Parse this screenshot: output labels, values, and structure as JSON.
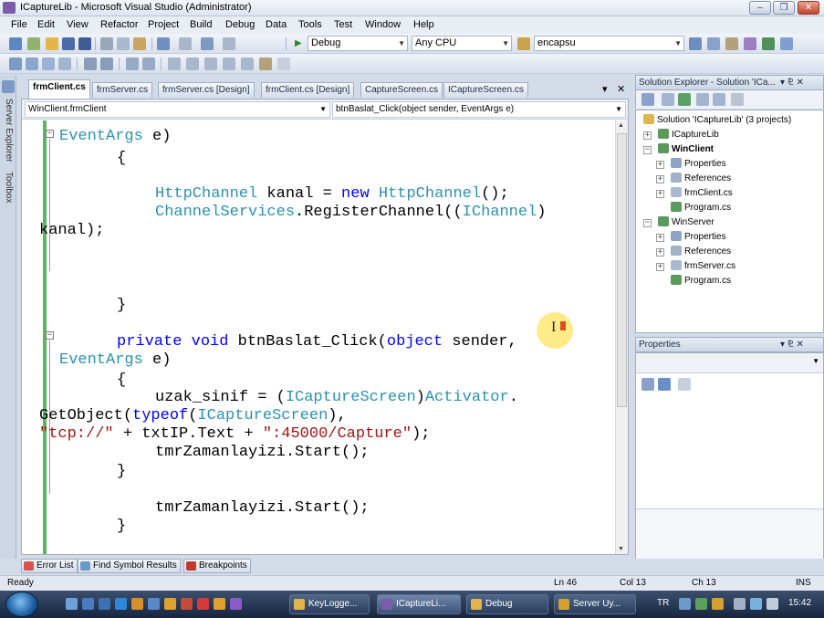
{
  "window": {
    "title": "ICaptureLib - Microsoft Visual Studio (Administrator)",
    "min_label": "–",
    "max_label": "❐",
    "close_label": "✕"
  },
  "menu": [
    "File",
    "Edit",
    "View",
    "Refactor",
    "Project",
    "Build",
    "Debug",
    "Data",
    "Tools",
    "Test",
    "Window",
    "Help"
  ],
  "toolbar": {
    "config": "Debug",
    "platform": "Any CPU",
    "find": "encapsu"
  },
  "left_strip": {
    "server_explorer": "Server Explorer",
    "toolbox": "Toolbox"
  },
  "doc_tabs": [
    "frmClient.cs",
    "frmServer.cs",
    "frmServer.cs [Design]",
    "frmClient.cs [Design]",
    "CaptureScreen.cs",
    "ICaptureScreen.cs"
  ],
  "doc_tabs_controls": {
    "dropdown": "▾",
    "close": "✕"
  },
  "navbar": {
    "class_combo": "WinClient.frmClient",
    "member_combo": "btnBaslat_Click(object sender, EventArgs e)"
  },
  "code": {
    "l1_type": "EventArgs",
    "l1_rest": " e)",
    "l2": "{",
    "l3_t1": "HttpChannel",
    "l3_mid": " kanal = ",
    "l3_kw": "new",
    "l3_sp": " ",
    "l3_t2": "HttpChannel",
    "l3_end": "();",
    "l4_t1": "ChannelServices",
    "l4_mid": ".RegisterChannel((",
    "l4_t2": "IChannel",
    "l4_end": ")",
    "l5": "kanal);",
    "l6": "}",
    "l7_kw1": "private",
    "l7_sp": " ",
    "l7_kw2": "void",
    "l7_mid": " btnBaslat_Click(",
    "l7_kw3": "object",
    "l7_end": " sender,",
    "l8_type": "EventArgs",
    "l8_rest": " e)",
    "l9": "{",
    "l10_a": "uzak_sinif = (",
    "l10_t1": "ICaptureScreen",
    "l10_b": ")",
    "l10_t2": "Activator",
    "l10_c": ".",
    "l11_a": "GetObject(",
    "l11_kw": "typeof",
    "l11_b": "(",
    "l11_t": "ICaptureScreen",
    "l11_c": "),",
    "l12_s1": "\"tcp://\"",
    "l12_mid": " + txtIP.Text + ",
    "l12_s2": "\":45000/Capture\"",
    "l12_end": ");",
    "l13": "tmrZamanlayizi.Start();",
    "l14": "}",
    "l15": "tmrZamanlayizi.Start();",
    "l16": "}"
  },
  "bottom_tabs": [
    "Error List",
    "Find Symbol Results",
    "Breakpoints"
  ],
  "solution_explorer": {
    "title": "Solution Explorer - Solution 'ICa...",
    "pin": "▾ ⅊ ✕",
    "items": [
      "Solution 'ICaptureLib' (3 projects)",
      "ICaptureLib",
      "WinClient",
      "Properties",
      "References",
      "frmClient.cs",
      "Program.cs",
      "WinServer",
      "Properties",
      "References",
      "frmServer.cs",
      "Program.cs"
    ]
  },
  "properties": {
    "title": "Properties",
    "pin": "▾ ⅊ ✕"
  },
  "status": {
    "ready": "Ready",
    "ln": "Ln 46",
    "col": "Col 13",
    "ch": "Ch 13",
    "ins": "INS"
  },
  "taskbar": {
    "buttons": [
      "KeyLogge...",
      "ICaptureLi...",
      "Debug",
      "Server Uy..."
    ],
    "lang": "TR",
    "clock": "15:42"
  },
  "colors": {
    "keyword": "#0000ff",
    "type": "#2b91af",
    "string": "#a31515"
  }
}
